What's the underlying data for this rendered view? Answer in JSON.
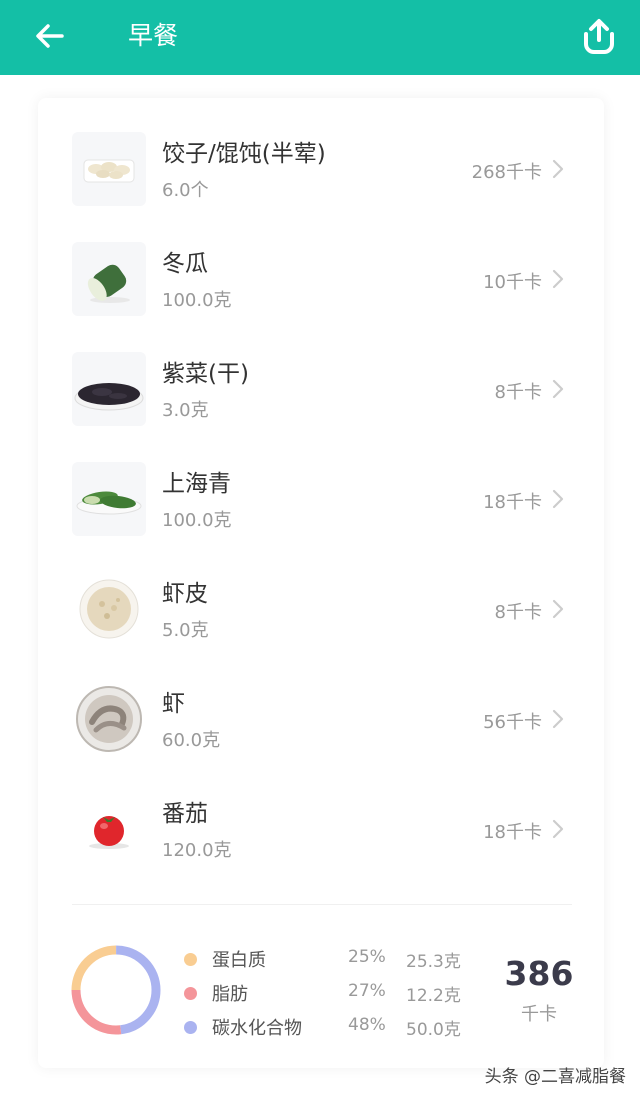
{
  "header": {
    "title": "早餐",
    "background": "#14bfa6",
    "back_icon": "arrow-left-icon",
    "share_icon": "share-upload-icon"
  },
  "foods": [
    {
      "name": "饺子/馄饨(半荤)",
      "amount": "6.0个",
      "kcal": "268千卡",
      "icon": "dumplings"
    },
    {
      "name": "冬瓜",
      "amount": "100.0克",
      "kcal": "10千卡",
      "icon": "winter-melon"
    },
    {
      "name": "紫菜(干)",
      "amount": "3.0克",
      "kcal": "8千卡",
      "icon": "seaweed"
    },
    {
      "name": "上海青",
      "amount": "100.0克",
      "kcal": "18千卡",
      "icon": "bok-choy"
    },
    {
      "name": "虾皮",
      "amount": "5.0克",
      "kcal": "8千卡",
      "icon": "dried-shrimp"
    },
    {
      "name": "虾",
      "amount": "60.0克",
      "kcal": "56千卡",
      "icon": "shrimp"
    },
    {
      "name": "番茄",
      "amount": "120.0克",
      "kcal": "18千卡",
      "icon": "tomato"
    }
  ],
  "summary": {
    "macros": [
      {
        "label": "蛋白质",
        "percent": "25%",
        "grams": "25.3克",
        "color": "#f9cd92",
        "share": 25
      },
      {
        "label": "脂肪",
        "percent": "27%",
        "grams": "12.2克",
        "color": "#f4959a",
        "share": 27
      },
      {
        "label": "碳水化合物",
        "percent": "48%",
        "grams": "50.0克",
        "color": "#aab3f0",
        "share": 48
      }
    ],
    "total": "386",
    "total_unit": "千卡"
  },
  "watermark": "头条 @二喜减脂餐"
}
